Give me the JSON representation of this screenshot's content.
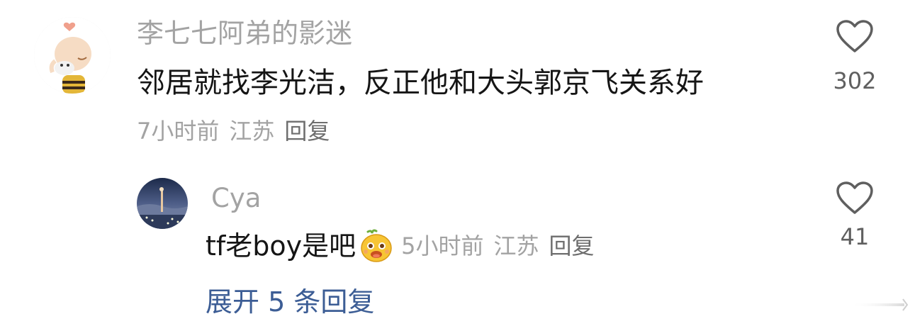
{
  "comment": {
    "username": "李七七阿弟的影迷",
    "text": "邻居就找李光洁，反正他和大头郭京飞关系好",
    "time": "7小时前",
    "location": "江苏",
    "reply_label": "回复",
    "like_icon": "heart-outline-icon",
    "like_count": "302",
    "avatar_icon": "cartoon-charlie-brown-avatar"
  },
  "reply": {
    "username": "Cya",
    "text": "tf老boy是吧",
    "emoji_icon": "smiling-yellow-blob-emoji",
    "time": "5小时前",
    "location": "江苏",
    "reply_label": "回复",
    "like_icon": "heart-outline-icon",
    "like_count": "41",
    "avatar_icon": "night-city-photo-avatar"
  },
  "expand": {
    "label": "展开 5 条回复"
  },
  "colors": {
    "username": "#a3a3a3",
    "text": "#151515",
    "meta": "#a3a3a3",
    "link": "#3c5d95",
    "heart": "#5f5f5f"
  }
}
